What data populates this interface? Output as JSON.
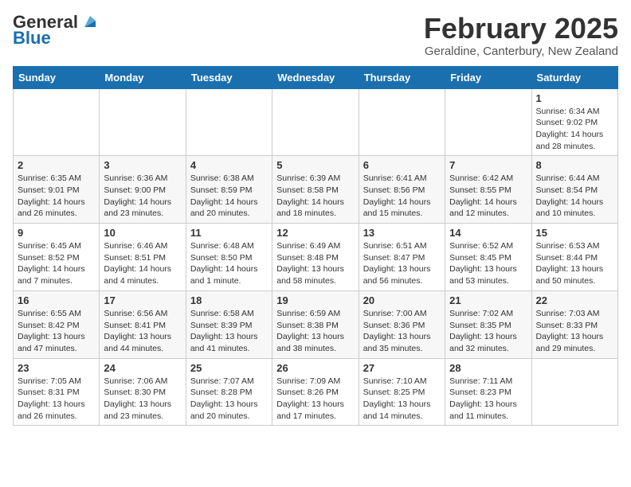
{
  "header": {
    "logo_general": "General",
    "logo_blue": "Blue",
    "month_title": "February 2025",
    "location": "Geraldine, Canterbury, New Zealand"
  },
  "days_of_week": [
    "Sunday",
    "Monday",
    "Tuesday",
    "Wednesday",
    "Thursday",
    "Friday",
    "Saturday"
  ],
  "weeks": [
    [
      {
        "day": "",
        "info": ""
      },
      {
        "day": "",
        "info": ""
      },
      {
        "day": "",
        "info": ""
      },
      {
        "day": "",
        "info": ""
      },
      {
        "day": "",
        "info": ""
      },
      {
        "day": "",
        "info": ""
      },
      {
        "day": "1",
        "info": "Sunrise: 6:34 AM\nSunset: 9:02 PM\nDaylight: 14 hours\nand 28 minutes."
      }
    ],
    [
      {
        "day": "2",
        "info": "Sunrise: 6:35 AM\nSunset: 9:01 PM\nDaylight: 14 hours\nand 26 minutes."
      },
      {
        "day": "3",
        "info": "Sunrise: 6:36 AM\nSunset: 9:00 PM\nDaylight: 14 hours\nand 23 minutes."
      },
      {
        "day": "4",
        "info": "Sunrise: 6:38 AM\nSunset: 8:59 PM\nDaylight: 14 hours\nand 20 minutes."
      },
      {
        "day": "5",
        "info": "Sunrise: 6:39 AM\nSunset: 8:58 PM\nDaylight: 14 hours\nand 18 minutes."
      },
      {
        "day": "6",
        "info": "Sunrise: 6:41 AM\nSunset: 8:56 PM\nDaylight: 14 hours\nand 15 minutes."
      },
      {
        "day": "7",
        "info": "Sunrise: 6:42 AM\nSunset: 8:55 PM\nDaylight: 14 hours\nand 12 minutes."
      },
      {
        "day": "8",
        "info": "Sunrise: 6:44 AM\nSunset: 8:54 PM\nDaylight: 14 hours\nand 10 minutes."
      }
    ],
    [
      {
        "day": "9",
        "info": "Sunrise: 6:45 AM\nSunset: 8:52 PM\nDaylight: 14 hours\nand 7 minutes."
      },
      {
        "day": "10",
        "info": "Sunrise: 6:46 AM\nSunset: 8:51 PM\nDaylight: 14 hours\nand 4 minutes."
      },
      {
        "day": "11",
        "info": "Sunrise: 6:48 AM\nSunset: 8:50 PM\nDaylight: 14 hours\nand 1 minute."
      },
      {
        "day": "12",
        "info": "Sunrise: 6:49 AM\nSunset: 8:48 PM\nDaylight: 13 hours\nand 58 minutes."
      },
      {
        "day": "13",
        "info": "Sunrise: 6:51 AM\nSunset: 8:47 PM\nDaylight: 13 hours\nand 56 minutes."
      },
      {
        "day": "14",
        "info": "Sunrise: 6:52 AM\nSunset: 8:45 PM\nDaylight: 13 hours\nand 53 minutes."
      },
      {
        "day": "15",
        "info": "Sunrise: 6:53 AM\nSunset: 8:44 PM\nDaylight: 13 hours\nand 50 minutes."
      }
    ],
    [
      {
        "day": "16",
        "info": "Sunrise: 6:55 AM\nSunset: 8:42 PM\nDaylight: 13 hours\nand 47 minutes."
      },
      {
        "day": "17",
        "info": "Sunrise: 6:56 AM\nSunset: 8:41 PM\nDaylight: 13 hours\nand 44 minutes."
      },
      {
        "day": "18",
        "info": "Sunrise: 6:58 AM\nSunset: 8:39 PM\nDaylight: 13 hours\nand 41 minutes."
      },
      {
        "day": "19",
        "info": "Sunrise: 6:59 AM\nSunset: 8:38 PM\nDaylight: 13 hours\nand 38 minutes."
      },
      {
        "day": "20",
        "info": "Sunrise: 7:00 AM\nSunset: 8:36 PM\nDaylight: 13 hours\nand 35 minutes."
      },
      {
        "day": "21",
        "info": "Sunrise: 7:02 AM\nSunset: 8:35 PM\nDaylight: 13 hours\nand 32 minutes."
      },
      {
        "day": "22",
        "info": "Sunrise: 7:03 AM\nSunset: 8:33 PM\nDaylight: 13 hours\nand 29 minutes."
      }
    ],
    [
      {
        "day": "23",
        "info": "Sunrise: 7:05 AM\nSunset: 8:31 PM\nDaylight: 13 hours\nand 26 minutes."
      },
      {
        "day": "24",
        "info": "Sunrise: 7:06 AM\nSunset: 8:30 PM\nDaylight: 13 hours\nand 23 minutes."
      },
      {
        "day": "25",
        "info": "Sunrise: 7:07 AM\nSunset: 8:28 PM\nDaylight: 13 hours\nand 20 minutes."
      },
      {
        "day": "26",
        "info": "Sunrise: 7:09 AM\nSunset: 8:26 PM\nDaylight: 13 hours\nand 17 minutes."
      },
      {
        "day": "27",
        "info": "Sunrise: 7:10 AM\nSunset: 8:25 PM\nDaylight: 13 hours\nand 14 minutes."
      },
      {
        "day": "28",
        "info": "Sunrise: 7:11 AM\nSunset: 8:23 PM\nDaylight: 13 hours\nand 11 minutes."
      },
      {
        "day": "",
        "info": ""
      }
    ]
  ]
}
